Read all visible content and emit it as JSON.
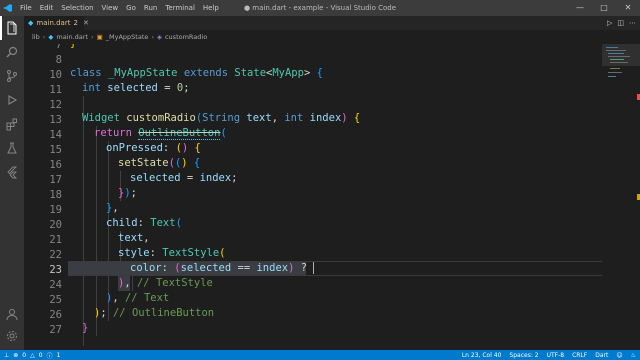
{
  "window": {
    "title": "● main.dart - example - Visual Studio Code",
    "menu": [
      "File",
      "Edit",
      "Selection",
      "View",
      "Go",
      "Run",
      "Terminal",
      "Help"
    ]
  },
  "tab": {
    "name": "main.dart",
    "modified_count": "2"
  },
  "breadcrumb": [
    "lib",
    "main.dart",
    "_MyAppState",
    "customRadio"
  ],
  "code": {
    "current_line": 23,
    "lines": [
      {
        "n": "7",
        "text": "}"
      },
      {
        "n": "8",
        "text": ""
      },
      {
        "n": "10",
        "text": "class _MyAppState extends State<MyApp> {"
      },
      {
        "n": "11",
        "text": "int selected = 0;"
      },
      {
        "n": "12",
        "text": ""
      },
      {
        "n": "13",
        "text": "Widget customRadio(String text, int index) {"
      },
      {
        "n": "14",
        "text": "return OutlineButton("
      },
      {
        "n": "15",
        "text": "onPressed: () {"
      },
      {
        "n": "16",
        "text": "setState(() {"
      },
      {
        "n": "17",
        "text": "selected = index;"
      },
      {
        "n": "18",
        "text": "});"
      },
      {
        "n": "19",
        "text": "},"
      },
      {
        "n": "20",
        "text": "child: Text("
      },
      {
        "n": "21",
        "text": "text,"
      },
      {
        "n": "22",
        "text": "style: TextStyle("
      },
      {
        "n": "23",
        "text": "color: (selected == index) ?"
      },
      {
        "n": "24",
        "text": "), // TextStyle"
      },
      {
        "n": "25",
        "text": "), // Text"
      },
      {
        "n": "26",
        "text": "); // OutlineButton"
      },
      {
        "n": "27",
        "text": "}"
      }
    ]
  },
  "status": {
    "errors": "0",
    "warnings": "0",
    "info": "1",
    "position": "Ln 23, Col 40",
    "spaces": "Spaces: 2",
    "encoding": "UTF-8",
    "eol": "CRLF",
    "language": "Dart"
  },
  "colors": {
    "accent": "#007acc",
    "keyword": "#569cd6",
    "type": "#4ec9b0",
    "function": "#dcdcaa",
    "variable": "#9cdcfe",
    "comment": "#6a9955"
  }
}
